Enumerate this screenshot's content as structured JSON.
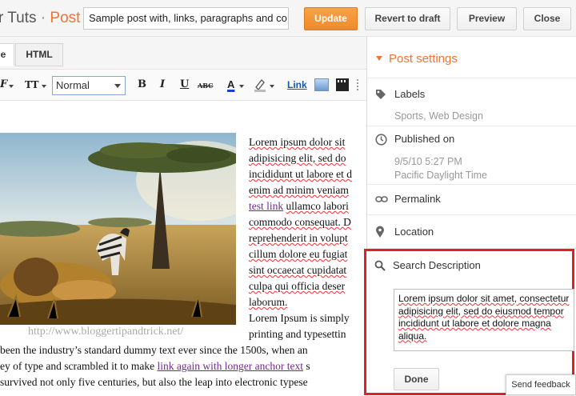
{
  "header": {
    "brand_prefix": "r Tuts",
    "brand_separator": "·",
    "brand_section": "Post",
    "post_title_value": "Sample post with, links, paragraphs and co",
    "update_label": "Update",
    "revert_label": "Revert to draft",
    "preview_label": "Preview",
    "close_label": "Close"
  },
  "mode_tabs": {
    "compose": "e",
    "html": "HTML"
  },
  "toolbar": {
    "font_glyph": "F",
    "text_size_glyph": "TT",
    "format_value": "Normal",
    "bold": "B",
    "italic": "I",
    "underline": "U",
    "strike": "ABC",
    "text_color": "A",
    "link_label": "Link"
  },
  "editor": {
    "watermark": "http://www.bloggertipandtrick.net/",
    "lines_right": [
      "Lorem ipsum dolor sit",
      "adipisicing elit, sed do",
      "incididunt ut labore et d",
      "enim ad minim veniam",
      "ullamco labori",
      "commodo consequat. D",
      "reprehenderit in volupt",
      "cillum dolore eu fugiat",
      "sint occaecat cupidatat",
      "culpa qui officia deser",
      "laborum.",
      "Lorem Ipsum is simply",
      "printing and typesettin"
    ],
    "test_link": "test link",
    "full_line_1": "been the industry’s standard dummy text ever since the 1500s, when an",
    "full_line_2_prefix": "ey of type and scrambled it to make ",
    "full_line_2_link": "link again with longer anchor text",
    "full_line_2_suffix": " s",
    "full_line_3": "survived not only five centuries, but also the leap into electronic typese"
  },
  "post_settings": {
    "title": "Post settings",
    "labels_title": "Labels",
    "labels_value": "Sports, Web Design",
    "published_title": "Published on",
    "published_date": "9/5/10 5:27 PM",
    "published_tz": "Pacific Daylight Time",
    "permalink_title": "Permalink",
    "location_title": "Location",
    "search_desc_title": "Search Description",
    "search_desc_value": "Lorem ipsum dolor sit amet, consectetur adipisicing elit, sed do eiusmod tempor incididunt ut labore et dolore magna aliqua.",
    "done_label": "Done"
  },
  "send_feedback": "Send feedback",
  "colors": {
    "accent": "#ee7432",
    "highlight_border": "#e21e2b",
    "link": "#6b2a96"
  },
  "icons": [
    "tag-icon",
    "clock-icon",
    "link-icon",
    "location-pin-icon",
    "search-icon",
    "image-icon",
    "video-icon"
  ]
}
